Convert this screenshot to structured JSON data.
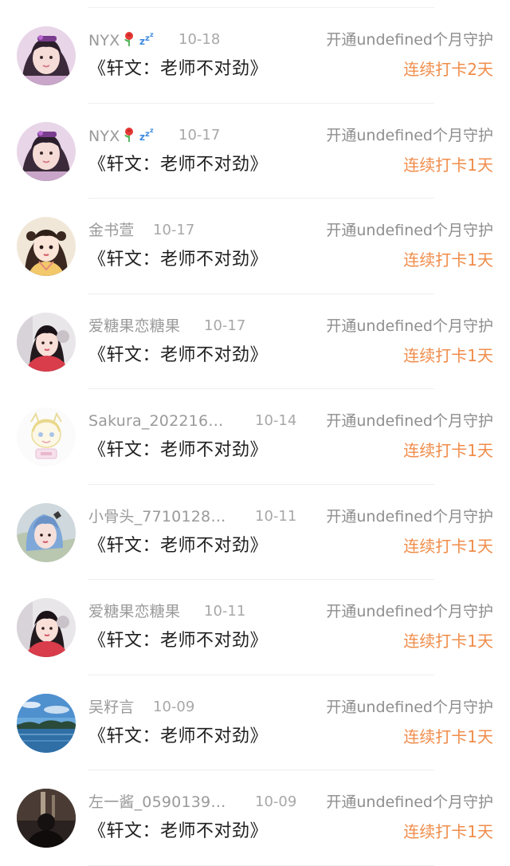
{
  "entries": [
    {
      "name": "NYX",
      "name_suffix_icons": [
        "rose-icon",
        "sleeping-zzz-icon"
      ],
      "date": "10-18",
      "action": "开通undefined个月守护",
      "title": "《轩文：老师不对劲》",
      "streak": "连续打卡2天",
      "avatar_icon": "girl-purple-hair-avatar-icon"
    },
    {
      "name": "NYX",
      "name_suffix_icons": [
        "rose-icon",
        "sleeping-zzz-icon"
      ],
      "date": "10-17",
      "action": "开通undefined个月守护",
      "title": "《轩文：老师不对劲》",
      "streak": "连续打卡1天",
      "avatar_icon": "girl-purple-hair-avatar-icon"
    },
    {
      "name": "金书萱",
      "date": "10-17",
      "action": "开通undefined个月守护",
      "title": "《轩文：老师不对劲》",
      "streak": "连续打卡1天",
      "avatar_icon": "anime-girl-avatar-icon"
    },
    {
      "name": "爱糖果恋糖果",
      "date": "10-17",
      "action": "开通undefined个月守护",
      "title": "《轩文：老师不对劲》",
      "streak": "连续打卡1天",
      "avatar_icon": "girl-red-coat-avatar-icon"
    },
    {
      "name": "Sakura_202216…",
      "date": "10-14",
      "action": "开通undefined个月守护",
      "title": "《轩文：老师不对劲》",
      "streak": "连续打卡1天",
      "avatar_icon": "cartoon-sketch-avatar-icon"
    },
    {
      "name": "小骨头_7710128…",
      "date": "10-11",
      "action": "开通undefined个月守护",
      "title": "《轩文：老师不对劲》",
      "streak": "连续打卡1天",
      "avatar_icon": "girl-blue-hair-avatar-icon"
    },
    {
      "name": "爱糖果恋糖果",
      "date": "10-11",
      "action": "开通undefined个月守护",
      "title": "《轩文：老师不对劲》",
      "streak": "连续打卡1天",
      "avatar_icon": "girl-red-coat-avatar-icon"
    },
    {
      "name": "吴籽言",
      "date": "10-09",
      "action": "开通undefined个月守护",
      "title": "《轩文：老师不对劲》",
      "streak": "连续打卡1天",
      "avatar_icon": "seascape-avatar-icon"
    },
    {
      "name": "左一酱_0590139…",
      "date": "10-09",
      "action": "开通undefined个月守护",
      "title": "《轩文：老师不对劲》",
      "streak": "连续打卡1天",
      "avatar_icon": "person-silhouette-avatar-icon"
    }
  ],
  "colors": {
    "name_text": "#9a9a9a",
    "title_text": "#1f1f1f",
    "action_text": "#8e8e8e",
    "streak_accent": "#f08c4a",
    "divider": "#efefef"
  }
}
